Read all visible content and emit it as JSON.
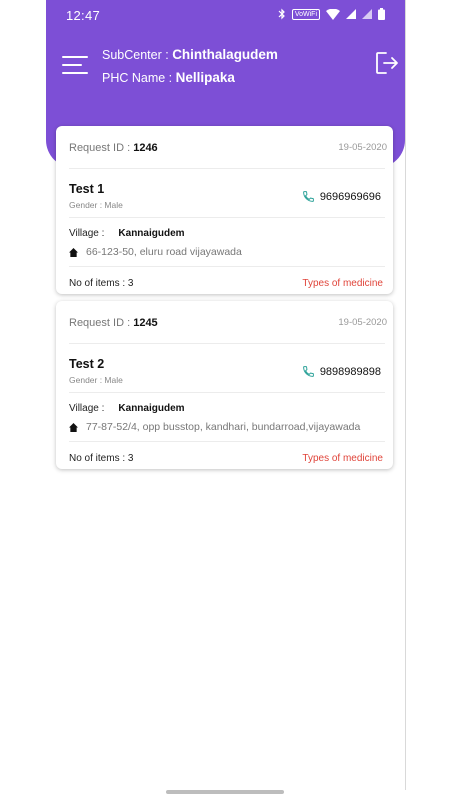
{
  "status_bar": {
    "time": "12:47",
    "vowifi": "VoWiFi"
  },
  "header": {
    "subcenter_label": "SubCenter : ",
    "subcenter_value": "Chinthalagudem",
    "phc_label": "PHC Name : ",
    "phc_value": "Nellipaka"
  },
  "colors": {
    "header_bg": "#7d4fd6",
    "accent_link": "#e0443a",
    "phone_icon": "#2aa198"
  },
  "requests": [
    {
      "request_label": "Request ID : ",
      "request_id": "1246",
      "date": "19-05-2020",
      "name": "Test 1",
      "gender": "Gender : Male",
      "phone": "9696969696",
      "village_label": "Village :",
      "village": "Kannaigudem",
      "address": "66-123-50, eluru road vijayawada",
      "items": "No of items : 3",
      "types_link": "Types of medicine"
    },
    {
      "request_label": "Request ID : ",
      "request_id": "1245",
      "date": "19-05-2020",
      "name": "Test 2",
      "gender": "Gender : Male",
      "phone": "9898989898",
      "village_label": "Village :",
      "village": "Kannaigudem",
      "address": "77-87-52/4, opp busstop, kandhari, bundarroad,vijayawada",
      "items": "No of items : 3",
      "types_link": "Types of medicine"
    }
  ]
}
